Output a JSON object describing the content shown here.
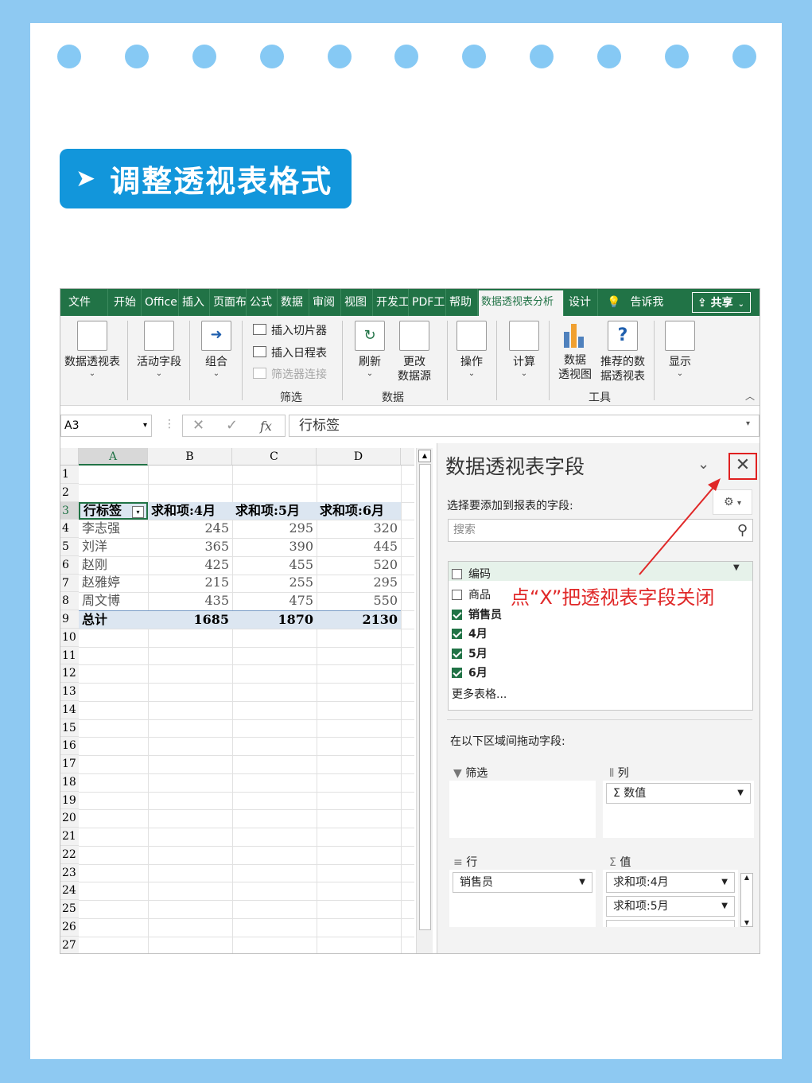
{
  "header": {
    "title": "调整透视表格式",
    "arrow_icon": "➤"
  },
  "tabs": [
    "文件",
    "开始",
    "Office",
    "插入",
    "页面布",
    "公式",
    "数据",
    "审阅",
    "视图",
    "开发工",
    "PDF工",
    "帮助",
    "数据透视表分析",
    "设计",
    "告诉我"
  ],
  "share_label": "共享",
  "ribbon": {
    "pivot_table": "数据透视表",
    "active_field": "活动字段",
    "group": "组合",
    "insert_slicer": "插入切片器",
    "insert_timeline": "插入日程表",
    "filter_connections": "筛选器连接",
    "group_filter": "筛选",
    "refresh": "刷新",
    "change_source_1": "更改",
    "change_source_2": "数据源",
    "group_data": "数据",
    "actions": "操作",
    "calculations": "计算",
    "pivot_chart_1": "数据",
    "pivot_chart_2": "透视图",
    "recommended_1": "推荐的数",
    "recommended_2": "据透视表",
    "group_tools": "工具",
    "show": "显示"
  },
  "formula_bar": {
    "name_box": "A3",
    "formula": "行标签",
    "fx": "fx"
  },
  "sheet": {
    "columns": [
      "A",
      "B",
      "C",
      "D"
    ],
    "row_numbers": [
      "1",
      "2",
      "3",
      "4",
      "5",
      "6",
      "7",
      "8",
      "9",
      "10",
      "11",
      "12",
      "13",
      "14",
      "15",
      "16",
      "17",
      "18",
      "19",
      "20",
      "21",
      "22",
      "23",
      "24",
      "25",
      "26",
      "27"
    ],
    "pivot_header": [
      "行标签",
      "求和项:4月",
      "求和项:5月",
      "求和项:6月"
    ],
    "pivot_rows": [
      [
        "李志强",
        "245",
        "295",
        "320"
      ],
      [
        "刘洋",
        "365",
        "390",
        "445"
      ],
      [
        "赵刚",
        "425",
        "455",
        "520"
      ],
      [
        "赵雅婷",
        "215",
        "255",
        "295"
      ],
      [
        "周文博",
        "435",
        "475",
        "550"
      ]
    ],
    "total_row": [
      "总计",
      "1685",
      "1870",
      "2130"
    ]
  },
  "pane": {
    "title": "数据透视表字段",
    "subtitle": "选择要添加到报表的字段:",
    "search_placeholder": "搜索",
    "fields": [
      {
        "label": "编码",
        "checked": false
      },
      {
        "label": "商品",
        "checked": false
      },
      {
        "label": "销售员",
        "checked": true
      },
      {
        "label": "4月",
        "checked": true
      },
      {
        "label": "5月",
        "checked": true
      },
      {
        "label": "6月",
        "checked": true
      }
    ],
    "more_tables": "更多表格...",
    "drag_label": "在以下区域间拖动字段:",
    "filters_label": "筛选",
    "columns_label": "列",
    "rows_label": "行",
    "values_label": "值",
    "columns_item": "Σ 数值",
    "rows_item": "销售员",
    "values_items": [
      "求和项:4月",
      "求和项:5月"
    ]
  },
  "annotation": "点“X”把透视表字段关闭",
  "colors": {
    "excel_green": "#217346",
    "title_blue": "#1296db",
    "border_blue": "#8ec9f2",
    "annotation_red": "#e02828",
    "total_fill": "#dce6f1"
  }
}
